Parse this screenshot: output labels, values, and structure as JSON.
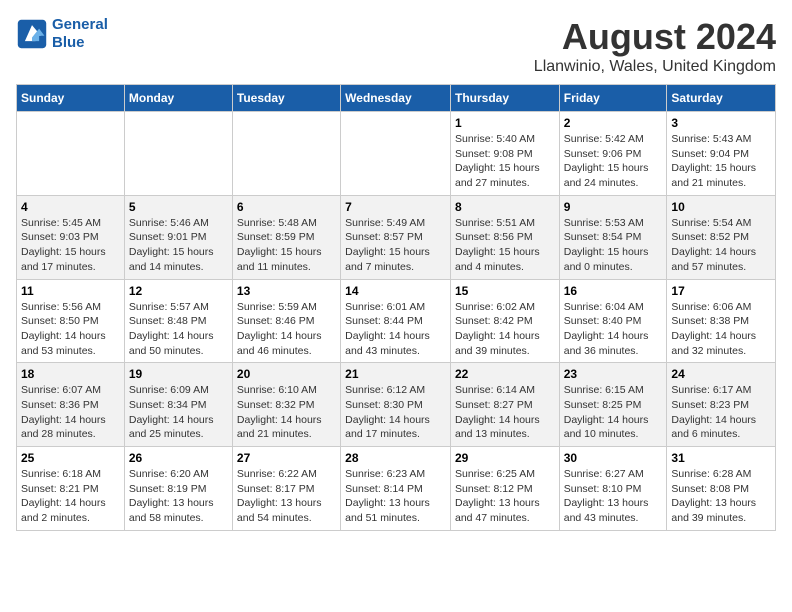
{
  "header": {
    "logo_line1": "General",
    "logo_line2": "Blue",
    "main_title": "August 2024",
    "subtitle": "Llanwinio, Wales, United Kingdom"
  },
  "days_of_week": [
    "Sunday",
    "Monday",
    "Tuesday",
    "Wednesday",
    "Thursday",
    "Friday",
    "Saturday"
  ],
  "weeks": [
    [
      {
        "num": "",
        "info": ""
      },
      {
        "num": "",
        "info": ""
      },
      {
        "num": "",
        "info": ""
      },
      {
        "num": "",
        "info": ""
      },
      {
        "num": "1",
        "info": "Sunrise: 5:40 AM\nSunset: 9:08 PM\nDaylight: 15 hours and 27 minutes."
      },
      {
        "num": "2",
        "info": "Sunrise: 5:42 AM\nSunset: 9:06 PM\nDaylight: 15 hours and 24 minutes."
      },
      {
        "num": "3",
        "info": "Sunrise: 5:43 AM\nSunset: 9:04 PM\nDaylight: 15 hours and 21 minutes."
      }
    ],
    [
      {
        "num": "4",
        "info": "Sunrise: 5:45 AM\nSunset: 9:03 PM\nDaylight: 15 hours and 17 minutes."
      },
      {
        "num": "5",
        "info": "Sunrise: 5:46 AM\nSunset: 9:01 PM\nDaylight: 15 hours and 14 minutes."
      },
      {
        "num": "6",
        "info": "Sunrise: 5:48 AM\nSunset: 8:59 PM\nDaylight: 15 hours and 11 minutes."
      },
      {
        "num": "7",
        "info": "Sunrise: 5:49 AM\nSunset: 8:57 PM\nDaylight: 15 hours and 7 minutes."
      },
      {
        "num": "8",
        "info": "Sunrise: 5:51 AM\nSunset: 8:56 PM\nDaylight: 15 hours and 4 minutes."
      },
      {
        "num": "9",
        "info": "Sunrise: 5:53 AM\nSunset: 8:54 PM\nDaylight: 15 hours and 0 minutes."
      },
      {
        "num": "10",
        "info": "Sunrise: 5:54 AM\nSunset: 8:52 PM\nDaylight: 14 hours and 57 minutes."
      }
    ],
    [
      {
        "num": "11",
        "info": "Sunrise: 5:56 AM\nSunset: 8:50 PM\nDaylight: 14 hours and 53 minutes."
      },
      {
        "num": "12",
        "info": "Sunrise: 5:57 AM\nSunset: 8:48 PM\nDaylight: 14 hours and 50 minutes."
      },
      {
        "num": "13",
        "info": "Sunrise: 5:59 AM\nSunset: 8:46 PM\nDaylight: 14 hours and 46 minutes."
      },
      {
        "num": "14",
        "info": "Sunrise: 6:01 AM\nSunset: 8:44 PM\nDaylight: 14 hours and 43 minutes."
      },
      {
        "num": "15",
        "info": "Sunrise: 6:02 AM\nSunset: 8:42 PM\nDaylight: 14 hours and 39 minutes."
      },
      {
        "num": "16",
        "info": "Sunrise: 6:04 AM\nSunset: 8:40 PM\nDaylight: 14 hours and 36 minutes."
      },
      {
        "num": "17",
        "info": "Sunrise: 6:06 AM\nSunset: 8:38 PM\nDaylight: 14 hours and 32 minutes."
      }
    ],
    [
      {
        "num": "18",
        "info": "Sunrise: 6:07 AM\nSunset: 8:36 PM\nDaylight: 14 hours and 28 minutes."
      },
      {
        "num": "19",
        "info": "Sunrise: 6:09 AM\nSunset: 8:34 PM\nDaylight: 14 hours and 25 minutes."
      },
      {
        "num": "20",
        "info": "Sunrise: 6:10 AM\nSunset: 8:32 PM\nDaylight: 14 hours and 21 minutes."
      },
      {
        "num": "21",
        "info": "Sunrise: 6:12 AM\nSunset: 8:30 PM\nDaylight: 14 hours and 17 minutes."
      },
      {
        "num": "22",
        "info": "Sunrise: 6:14 AM\nSunset: 8:27 PM\nDaylight: 14 hours and 13 minutes."
      },
      {
        "num": "23",
        "info": "Sunrise: 6:15 AM\nSunset: 8:25 PM\nDaylight: 14 hours and 10 minutes."
      },
      {
        "num": "24",
        "info": "Sunrise: 6:17 AM\nSunset: 8:23 PM\nDaylight: 14 hours and 6 minutes."
      }
    ],
    [
      {
        "num": "25",
        "info": "Sunrise: 6:18 AM\nSunset: 8:21 PM\nDaylight: 14 hours and 2 minutes."
      },
      {
        "num": "26",
        "info": "Sunrise: 6:20 AM\nSunset: 8:19 PM\nDaylight: 13 hours and 58 minutes."
      },
      {
        "num": "27",
        "info": "Sunrise: 6:22 AM\nSunset: 8:17 PM\nDaylight: 13 hours and 54 minutes."
      },
      {
        "num": "28",
        "info": "Sunrise: 6:23 AM\nSunset: 8:14 PM\nDaylight: 13 hours and 51 minutes."
      },
      {
        "num": "29",
        "info": "Sunrise: 6:25 AM\nSunset: 8:12 PM\nDaylight: 13 hours and 47 minutes."
      },
      {
        "num": "30",
        "info": "Sunrise: 6:27 AM\nSunset: 8:10 PM\nDaylight: 13 hours and 43 minutes."
      },
      {
        "num": "31",
        "info": "Sunrise: 6:28 AM\nSunset: 8:08 PM\nDaylight: 13 hours and 39 minutes."
      }
    ]
  ]
}
